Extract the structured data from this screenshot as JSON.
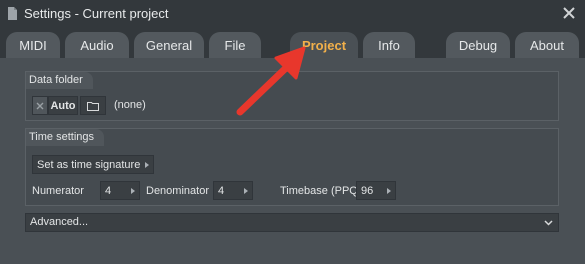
{
  "window": {
    "title": "Settings - Current project"
  },
  "tabs": [
    {
      "label": "MIDI"
    },
    {
      "label": "Audio"
    },
    {
      "label": "General"
    },
    {
      "label": "File"
    },
    {
      "label": "Project",
      "active": true
    },
    {
      "label": "Info"
    },
    {
      "label": "Debug"
    },
    {
      "label": "About"
    }
  ],
  "data_folder": {
    "label": "Data folder",
    "auto_label": "Auto",
    "value": "(none)"
  },
  "time_settings": {
    "label": "Time settings",
    "set_time_signature": "Set as time signature",
    "numerator_label": "Numerator",
    "numerator_value": "4",
    "denominator_label": "Denominator",
    "denominator_value": "4",
    "timebase_label": "Timebase (PPQ)",
    "timebase_value": "96"
  },
  "advanced": {
    "label": "Advanced..."
  },
  "colors": {
    "active_tab_text": "#f2b04a",
    "annotation_arrow": "#e8372c"
  },
  "icons": [
    "app-icon",
    "close-icon",
    "clear-x-icon",
    "folder-icon",
    "chevron-right-icon",
    "chevron-down-icon"
  ]
}
